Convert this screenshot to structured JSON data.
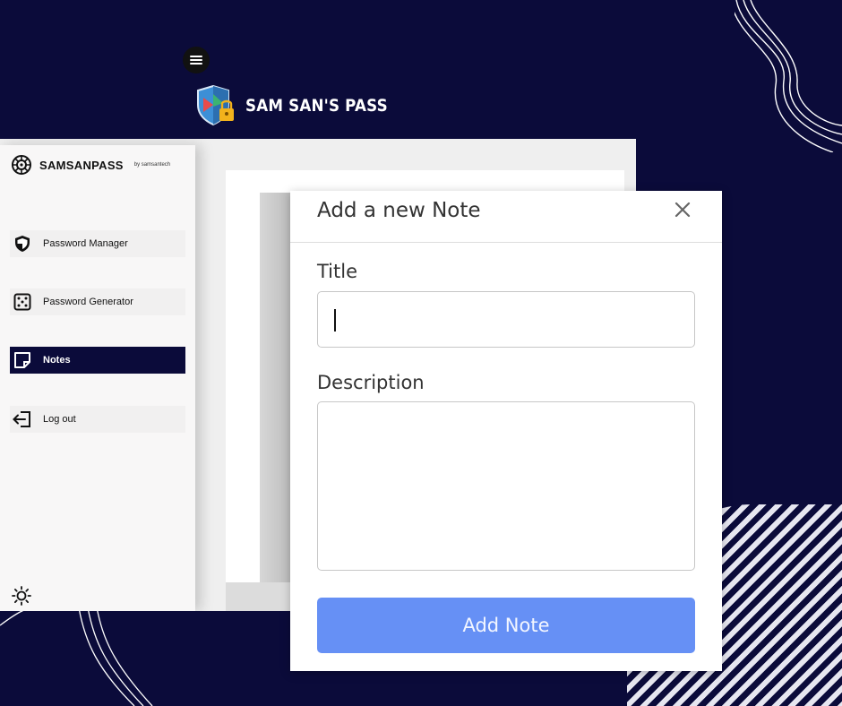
{
  "brand": {
    "name": "SAM SAN'S PASS"
  },
  "sidebar": {
    "logo_text": "SAMSANPASS",
    "logo_by": "by samsantech",
    "items": [
      {
        "label": "Password Manager",
        "icon": "shield-icon",
        "active": false
      },
      {
        "label": "Password Generator",
        "icon": "dice-icon",
        "active": false
      },
      {
        "label": "Notes",
        "icon": "note-icon",
        "active": true
      },
      {
        "label": "Log out",
        "icon": "logout-icon",
        "active": false
      }
    ]
  },
  "modal": {
    "title": "Add a new Note",
    "title_label": "Title",
    "title_value": "",
    "description_label": "Description",
    "description_value": "",
    "submit_label": "Add Note"
  },
  "colors": {
    "background": "#0b0b3a",
    "active_nav": "#0b0b3a",
    "submit": "#6690f5"
  }
}
